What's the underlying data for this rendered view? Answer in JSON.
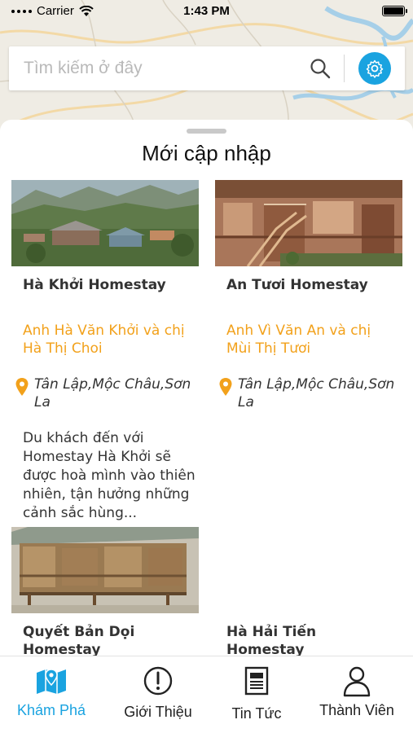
{
  "status_bar": {
    "carrier": "Carrier",
    "time": "1:43 PM"
  },
  "search": {
    "placeholder": "Tìm kiếm ở đây",
    "value": ""
  },
  "sheet": {
    "title": "Mới cập nhập",
    "cards": [
      {
        "name": "Hà Khởi Homestay",
        "owner": "Anh Hà Văn Khởi và chị Hà Thị Choi",
        "location": "Tân Lập,Mộc Châu,Sơn La",
        "description": "Du khách đến với Homestay Hà Khởi sẽ được hoà mình vào thiên nhiên, tận hưởng những cảnh sắc hùng..."
      },
      {
        "name": "An Tươi Homestay",
        "owner": "Anh Vì Văn An và chị Mùi Thị Tươi",
        "location": "Tân Lập,Mộc Châu,Sơn La",
        "description": ""
      },
      {
        "name": "Quyết Bản Dọi Homestay",
        "owner": "",
        "location": "",
        "description": ""
      },
      {
        "name": "Hà Hải Tiến Homestay",
        "owner": "",
        "location": "",
        "description": ""
      }
    ]
  },
  "tabs": [
    {
      "label": "Khám Phá",
      "icon": "map-icon",
      "active": true
    },
    {
      "label": "Giới Thiệu",
      "icon": "info-circle-icon",
      "active": false
    },
    {
      "label": "Tin Tức",
      "icon": "newspaper-icon",
      "active": false
    },
    {
      "label": "Thành Viên",
      "icon": "user-icon",
      "active": false
    }
  ],
  "colors": {
    "accent": "#1aa3e0",
    "owner_text": "#f2a11b",
    "pin": "#f2a11b"
  }
}
